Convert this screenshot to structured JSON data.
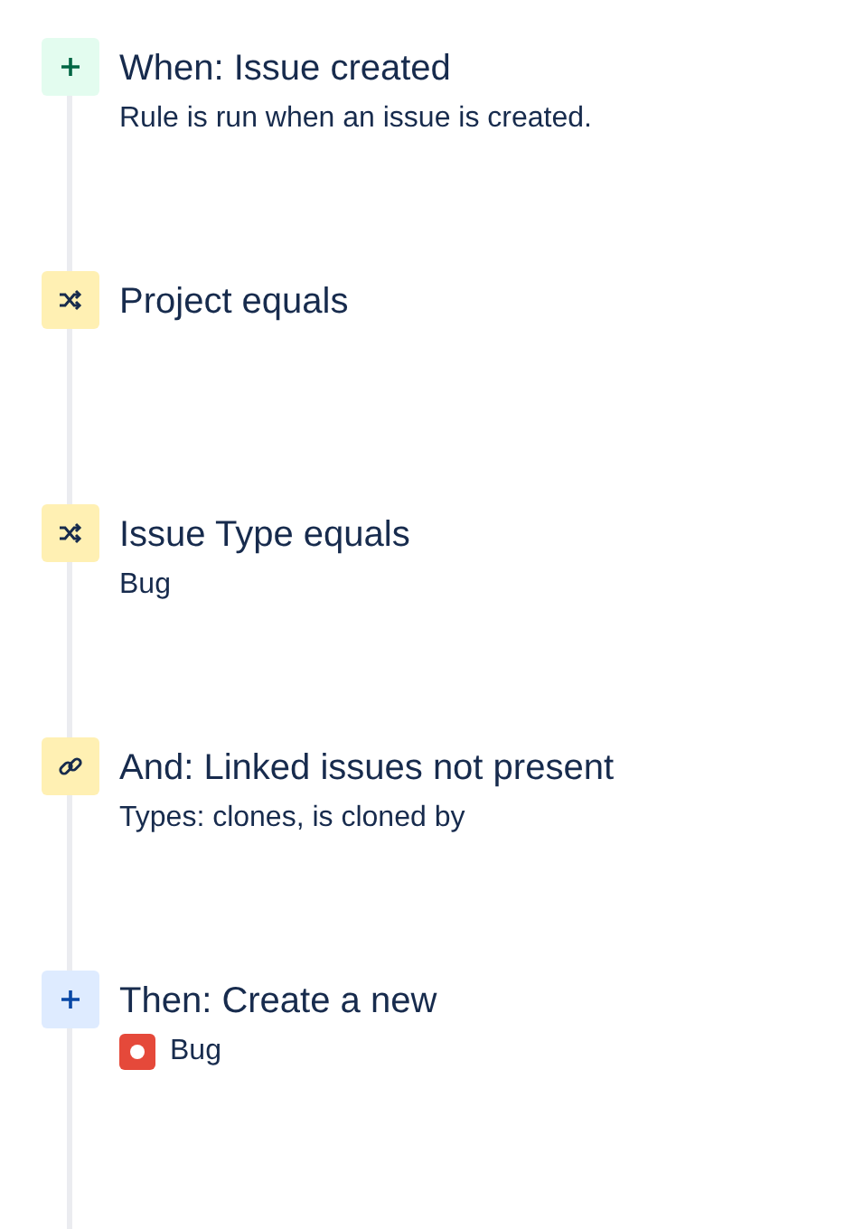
{
  "steps": [
    {
      "kind": "trigger",
      "title": "When: Issue created",
      "detail": {
        "kind": "text",
        "text": "Rule is run when an issue is created."
      }
    },
    {
      "kind": "condition",
      "title": "Project equals"
    },
    {
      "kind": "condition",
      "title": "Issue Type equals",
      "detail": {
        "kind": "text",
        "text": "Bug"
      }
    },
    {
      "kind": "link",
      "title": "And: Linked issues not present",
      "detail": {
        "kind": "text",
        "text": "Types: clones, is cloned by"
      }
    },
    {
      "kind": "action",
      "title": "Then: Create a new",
      "detail": {
        "kind": "issue-type",
        "text": "Bug"
      }
    }
  ]
}
